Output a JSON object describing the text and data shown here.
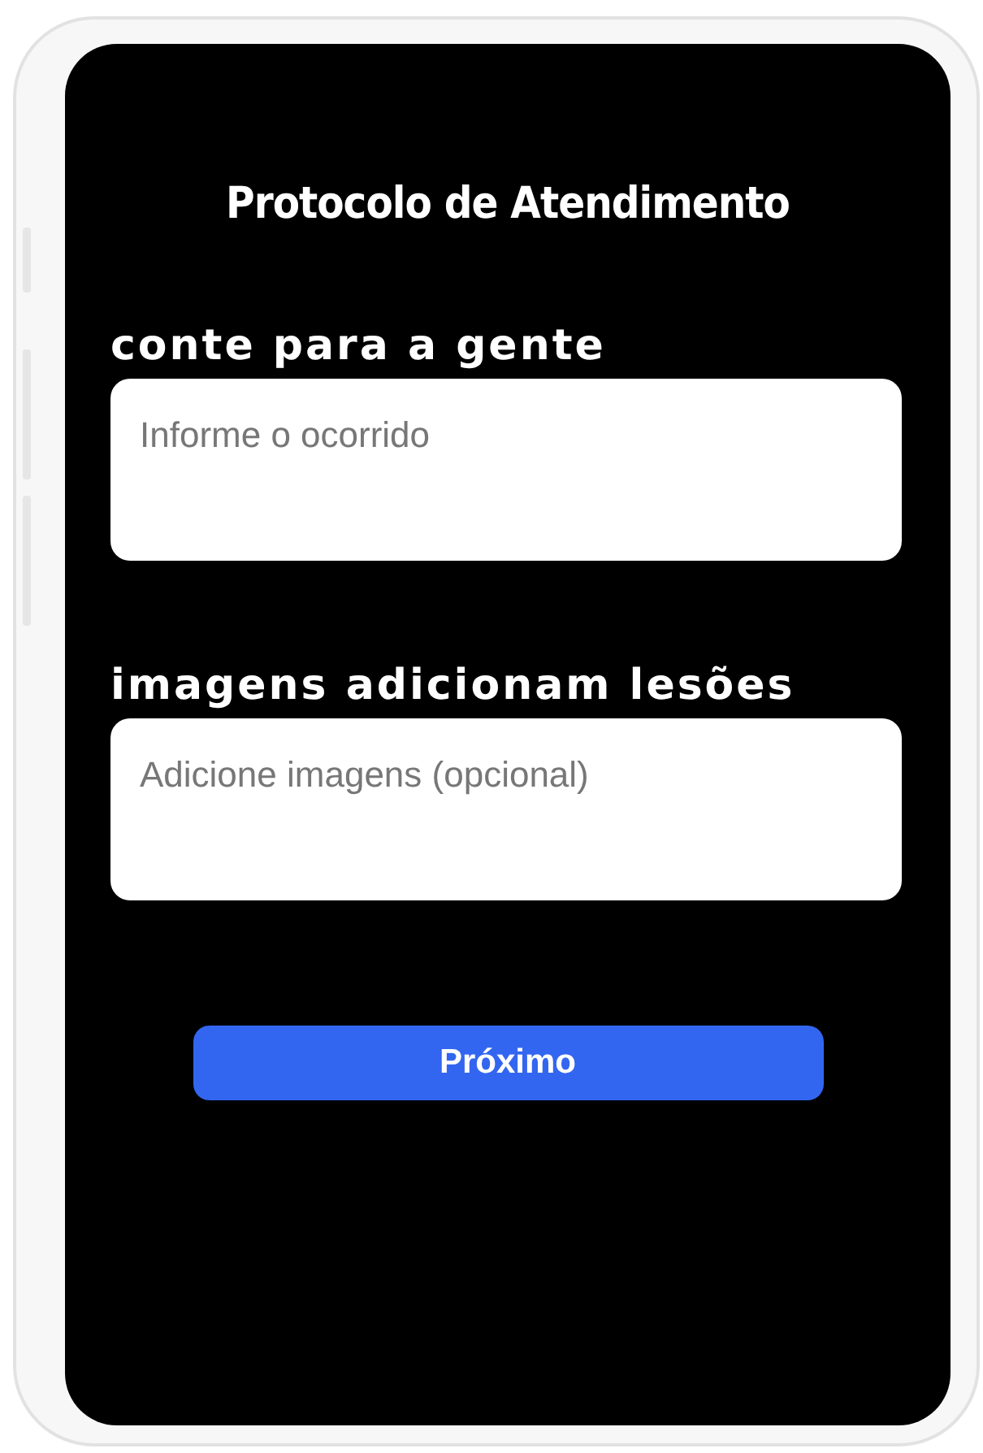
{
  "title": "Protocolo de Atendimento",
  "fields": [
    {
      "label": "conte para a gente",
      "placeholder": "Informe o ocorrido"
    },
    {
      "label": "imagens adicionam lesões",
      "placeholder": "Adicione imagens (opcional)"
    }
  ],
  "button": "Próximo"
}
